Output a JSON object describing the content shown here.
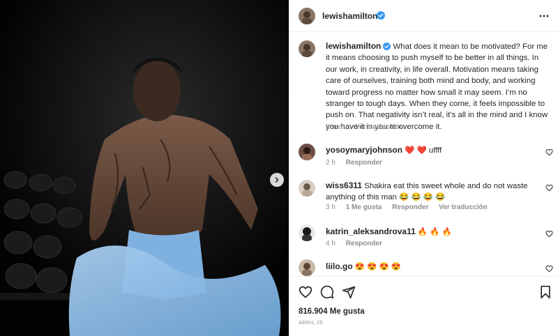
{
  "post": {
    "author": "lewishamilton",
    "caption": "What does it mean to be motivated? For me it means choosing to push myself to be better in all things. In our work, in creativity, in life overall. Motivation means taking care of ourselves, training both mind and body, and working toward progress no matter how small it may seem. I’m no stranger to tough days. When they come, it feels impossible to push on. That negativity isn’t real, it’s all in the mind and I know you have it in you to overcome it.",
    "time": "2 sem",
    "see_translation": "Ver traducción",
    "likes": "816.904 Me gusta",
    "date": "ABRIL 25"
  },
  "comments": [
    {
      "user": "yosoymaryjohnson",
      "text": "❤️ ❤️ uffff",
      "time": "2 h",
      "reply": "Responder"
    },
    {
      "user": "wiss6311",
      "text": "Shakira eat this sweet whole and do not waste anything of this man 😂 😂 😂 😂",
      "time": "3 h",
      "likes": "1 Me gusta",
      "reply": "Responder",
      "translate": "Ver traducción"
    },
    {
      "user": "katrin_aleksandrova11",
      "text": "🔥 🔥 🔥",
      "time": "4 h",
      "reply": "Responder"
    },
    {
      "user": "liilo.go",
      "text": "😍 😍 😍 😍"
    }
  ],
  "icons": {
    "verified": "verified-badge-icon",
    "more": "more-options-icon",
    "like": "heart-icon",
    "comment": "comment-icon",
    "share": "share-icon",
    "save": "bookmark-icon",
    "next": "chevron-right-icon"
  },
  "colors": {
    "verified": "#3897f0",
    "text": "#262626",
    "muted": "#8e8e8e"
  }
}
